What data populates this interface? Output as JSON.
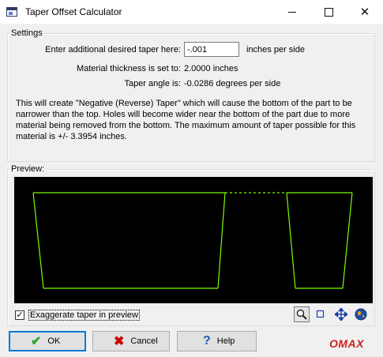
{
  "window": {
    "title": "Taper Offset Calculator",
    "minimize_icon": "minimize-icon",
    "maximize_icon": "maximize-icon",
    "close_icon": "close-icon"
  },
  "settings": {
    "legend": "Settings",
    "taper_label": "Enter additional desired taper here:",
    "taper_value": "-.001",
    "taper_units": "inches per side",
    "thickness_label": "Material thickness is set to:",
    "thickness_value": "2.0000 inches",
    "angle_label": "Taper angle is:",
    "angle_value": "-0.0286 degrees per side",
    "description": "This will create \"Negative (Reverse) Taper\" which will cause the bottom of the part to be narrower than the top.  Holes will become wider near the bottom of the part due to more material being removed from the bottom.  The maximum amount of taper possible for this material is +/- 3.3954 inches."
  },
  "preview": {
    "legend": "Preview:",
    "exaggerate_label": "Exaggerate taper in preview",
    "exaggerate_checked": true,
    "check_mark": "✓",
    "line_color": "#7cfc00",
    "tools": [
      "magnifier-icon",
      "rectangle-icon",
      "pan-arrows-icon",
      "globe-icon"
    ]
  },
  "buttons": {
    "ok_label": "OK",
    "cancel_label": "Cancel",
    "help_label": "Help",
    "ok_icon": "✔",
    "cancel_icon": "✖",
    "help_icon": "?"
  },
  "brand": {
    "logo_text": "OMAX"
  }
}
